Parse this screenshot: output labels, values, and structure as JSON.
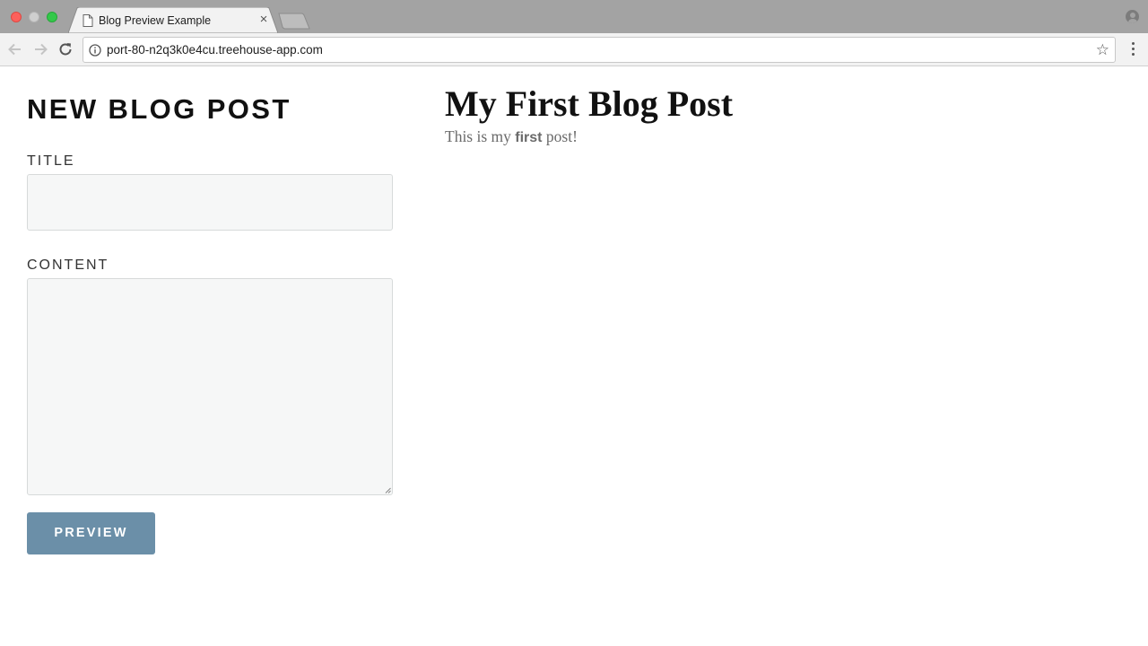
{
  "browser": {
    "tab_title": "Blog Preview Example",
    "url": "port-80-n2q3k0e4cu.treehouse-app.com",
    "close_glyph": "×",
    "star_glyph": "☆"
  },
  "form": {
    "heading": "NEW BLOG POST",
    "title_label": "TITLE",
    "title_value": "",
    "content_label": "CONTENT",
    "content_value": "",
    "preview_button": "PREVIEW"
  },
  "preview": {
    "title": "My First Blog Post",
    "body_before": "This is my ",
    "body_strong": "first",
    "body_after": " post!"
  },
  "icons": {
    "page": "page-icon",
    "back": "arrow-left-icon",
    "forward": "arrow-right-icon",
    "reload": "reload-icon",
    "info": "info-icon",
    "star": "star-icon",
    "menu": "kebab-menu-icon",
    "profile": "profile-icon"
  },
  "colors": {
    "button": "#6b8fa8",
    "field_background": "#f6f7f7",
    "titlebar": "#a3a3a3"
  }
}
